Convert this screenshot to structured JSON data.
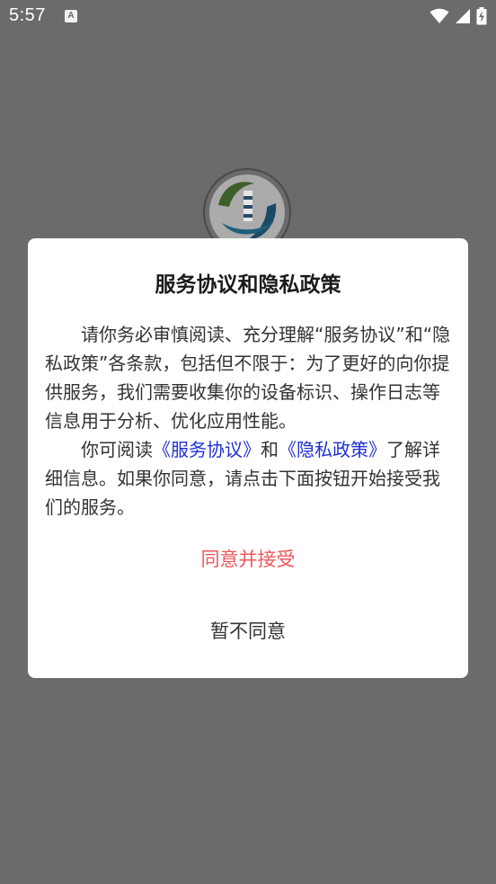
{
  "status_bar": {
    "time": "5:57",
    "notification_icon_letter": "A",
    "icons": [
      "wifi-icon",
      "signal-icon",
      "battery-charging-icon"
    ]
  },
  "background": {
    "logo_icon": "lighthouse-logo"
  },
  "dialog": {
    "title": "服务协议和隐私政策",
    "paragraph1": "请你务必审慎阅读、充分理解“服务协议”和“隐私政策”各条款，包括但不限于：为了更好的向你提供服务，我们需要收集你的设备标识、操作日志等信息用于分析、优化应用性能。",
    "paragraph2_prefix": "你可阅读",
    "service_agreement_link": "《服务协议》",
    "paragraph2_and": "和",
    "privacy_policy_link": "《隐私政策》",
    "paragraph2_suffix": "了解详细信息。如果你同意，请点击下面按钮开始接受我们的服务。",
    "agree_button": "同意并接受",
    "decline_button": "暂不同意"
  },
  "colors": {
    "overlay": "#6b6b6b",
    "agree": "#f0555c",
    "link": "#1f2fd6"
  }
}
